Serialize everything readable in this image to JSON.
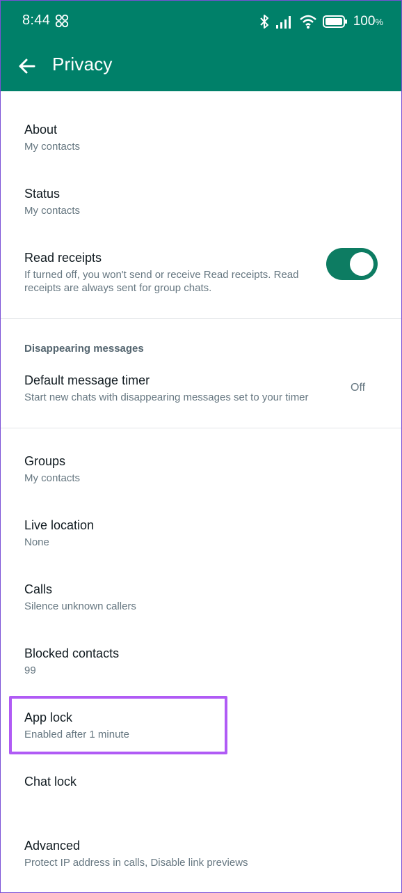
{
  "status_bar": {
    "time": "8:44",
    "battery_percent": "100",
    "battery_symbol": "%",
    "icons": [
      "fan-icon",
      "bluetooth-icon",
      "signal-icon",
      "wifi-icon",
      "battery-icon"
    ]
  },
  "app_bar": {
    "title": "Privacy"
  },
  "items": {
    "about": {
      "title": "About",
      "subtitle": "My contacts"
    },
    "status": {
      "title": "Status",
      "subtitle": "My contacts"
    },
    "read_receipts": {
      "title": "Read receipts",
      "subtitle_line1": "If turned off, you won't send or receive Read receipts. Read",
      "subtitle_line2": "receipts are always sent for group chats.",
      "toggle_on": true
    },
    "disappearing_header": "Disappearing messages",
    "default_timer": {
      "title": "Default message timer",
      "subtitle": "Start new chats with disappearing messages set to your timer",
      "value": "Off"
    },
    "groups": {
      "title": "Groups",
      "subtitle": "My contacts"
    },
    "live_location": {
      "title": "Live location",
      "subtitle": "None"
    },
    "calls": {
      "title": "Calls",
      "subtitle": "Silence unknown callers"
    },
    "blocked": {
      "title": "Blocked contacts",
      "subtitle": "99"
    },
    "app_lock": {
      "title": "App lock",
      "subtitle": "Enabled after 1 minute"
    },
    "chat_lock": {
      "title": "Chat lock"
    },
    "advanced": {
      "title": "Advanced",
      "subtitle": "Protect IP address in calls, Disable link previews"
    }
  },
  "colors": {
    "header": "#008069",
    "toggle": "#0d7c62",
    "highlight": "#b05bf5"
  }
}
